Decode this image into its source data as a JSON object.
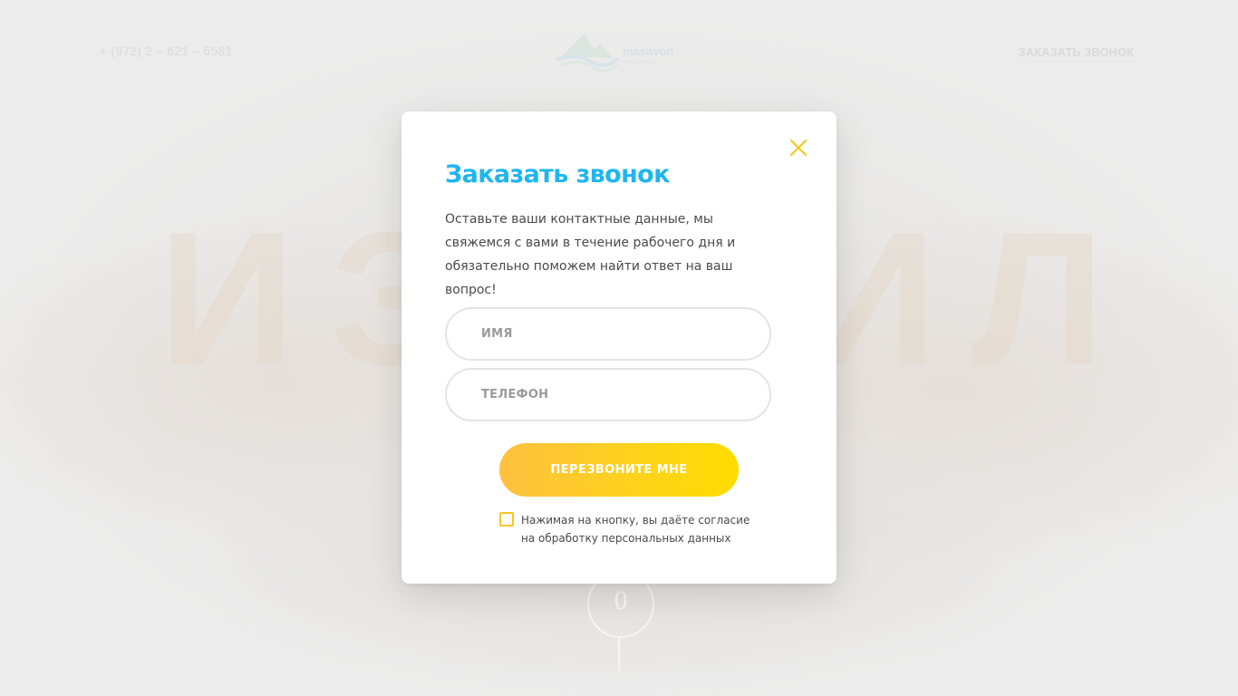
{
  "background": {
    "phone": "+ (972) 2 – 621 – 6581",
    "logo_name": "masavon",
    "logo_tagline": "travel agency",
    "callback_link": "ЗАКАЗАТЬ ЗВОНОК",
    "headline": "ИЗРАИЛЬ",
    "circle_number": "0"
  },
  "modal": {
    "title": "Заказать звонок",
    "description": "Оставьте ваши контактные данные, мы свяжемся с вами в течение рабочего дня и обязательно поможем найти ответ на ваш вопрос!",
    "name_field": {
      "placeholder": "ИМЯ",
      "value": ""
    },
    "phone_field": {
      "placeholder": "ТЕЛЕФОН",
      "value": ""
    },
    "submit_label": "ПЕРЕЗВОНИТЕ МНЕ",
    "consent_checked": false,
    "consent_text": "Нажимая на кнопку, вы даёте согласие на обработку персональных данных",
    "close_icon": "close-icon"
  },
  "colors": {
    "title": "#1fb6f0",
    "accent_yellow": "#fed21c",
    "close": "#f6c81e",
    "checkbox_border": "#f9c52a"
  }
}
